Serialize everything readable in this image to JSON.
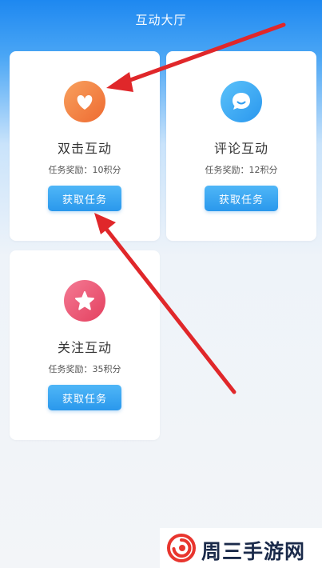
{
  "header": {
    "title": "互动大厅"
  },
  "cards": [
    {
      "title": "双击互动",
      "reward": "任务奖励：10积分",
      "button": "获取任务",
      "icon": "heart-icon",
      "gradient": [
        "#f8a15e",
        "#ee6a31"
      ]
    },
    {
      "title": "评论互动",
      "reward": "任务奖励：12积分",
      "button": "获取任务",
      "icon": "comment-icon",
      "gradient": [
        "#5bc2fa",
        "#2a97ee"
      ]
    },
    {
      "title": "关注互动",
      "reward": "任务奖励：35积分",
      "button": "获取任务",
      "icon": "star-icon",
      "gradient": [
        "#f47a94",
        "#e4405f"
      ]
    }
  ],
  "annotation_arrow_color": "#e0272a",
  "watermark": {
    "text": "周三手游网",
    "logo": "swirl-logo-icon",
    "logo_color": "#e8352e"
  }
}
